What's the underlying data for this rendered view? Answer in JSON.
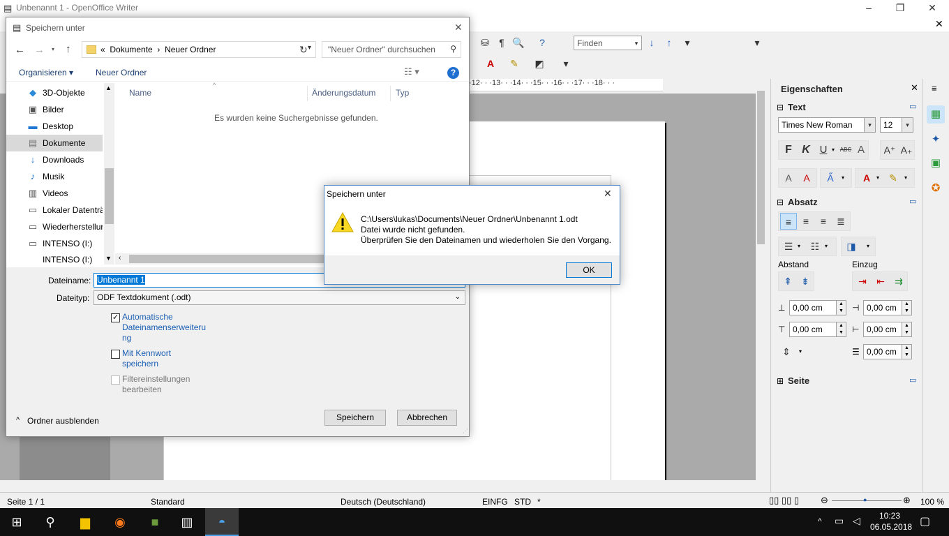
{
  "window": {
    "title": "Unbenannt 1 - OpenOffice Writer",
    "minimize": "–",
    "maximize": "❐",
    "close": "✕",
    "doc_close": "✕"
  },
  "toolbar": {
    "find_placeholder": "Finden"
  },
  "ruler": {
    "marks": "·12· · ·13· · ·14· · ·15· · ·16· · ·17· · ·18· · ·"
  },
  "sidebar": {
    "title": "Eigenschaften",
    "close": "✕",
    "text_section": "Text",
    "font_name": "Times New Roman",
    "font_size": "12",
    "paragraph_section": "Absatz",
    "spacing_label": "Abstand",
    "indent_label": "Einzug",
    "spacing_above": "0,00 cm",
    "spacing_below": "0,00 cm",
    "indent_before": "0,00 cm",
    "indent_after": "0,00 cm",
    "indent_first": "0,00 cm",
    "page_section": "Seite"
  },
  "statusbar": {
    "page": "Seite 1 / 1",
    "style": "Standard",
    "language": "Deutsch (Deutschland)",
    "insert_mode": "EINFG",
    "selection_mode": "STD",
    "modified": "*",
    "zoom": "100 %"
  },
  "taskbar": {
    "time": "10:23",
    "date": "06.05.2018"
  },
  "save_dialog": {
    "title": "Speichern unter",
    "breadcrumb": [
      "«",
      "Dokumente",
      "›",
      "Neuer Ordner"
    ],
    "search_placeholder": "\"Neuer Ordner\" durchsuchen",
    "organize": "Organisieren ▾",
    "new_folder": "Neuer Ordner",
    "nav_items": [
      {
        "label": "3D-Objekte",
        "icon": "cube-icon"
      },
      {
        "label": "Bilder",
        "icon": "pictures-icon"
      },
      {
        "label": "Desktop",
        "icon": "desktop-icon"
      },
      {
        "label": "Dokumente",
        "icon": "documents-icon"
      },
      {
        "label": "Downloads",
        "icon": "download-icon"
      },
      {
        "label": "Musik",
        "icon": "music-icon"
      },
      {
        "label": "Videos",
        "icon": "video-icon"
      },
      {
        "label": "Lokaler Datenträ",
        "icon": "drive-icon"
      },
      {
        "label": "Wiederherstellur",
        "icon": "drive-icon"
      },
      {
        "label": "INTENSO (I:)",
        "icon": "usb-drive-icon"
      },
      {
        "label": "INTENSO (I:)",
        "icon": "usb-drive-icon"
      }
    ],
    "columns": [
      "Name",
      "Änderungsdatum",
      "Typ"
    ],
    "empty_message": "Es wurden keine Suchergebnisse gefunden.",
    "filename_label": "Dateiname:",
    "filename_value": "Unbenannt 1",
    "filetype_label": "Dateityp:",
    "filetype_value": "ODF Textdokument (.odt)",
    "auto_extension": "Automatische Dateinamenserweiteru ng",
    "with_password": "Mit Kennwort speichern",
    "filter_settings": "Filtereinstellungen bearbeiten",
    "hide_folders": "Ordner ausblenden",
    "save_button": "Speichern",
    "cancel_button": "Abbrechen"
  },
  "message_box": {
    "title": "Speichern unter",
    "line1": "C:\\Users\\lukas\\Documents\\Neuer Ordner\\Unbenannt 1.odt",
    "line2": "Datei wurde nicht gefunden.",
    "line3": "Überprüfen Sie den Dateinamen und wiederholen Sie den Vorgang.",
    "ok": "OK"
  }
}
